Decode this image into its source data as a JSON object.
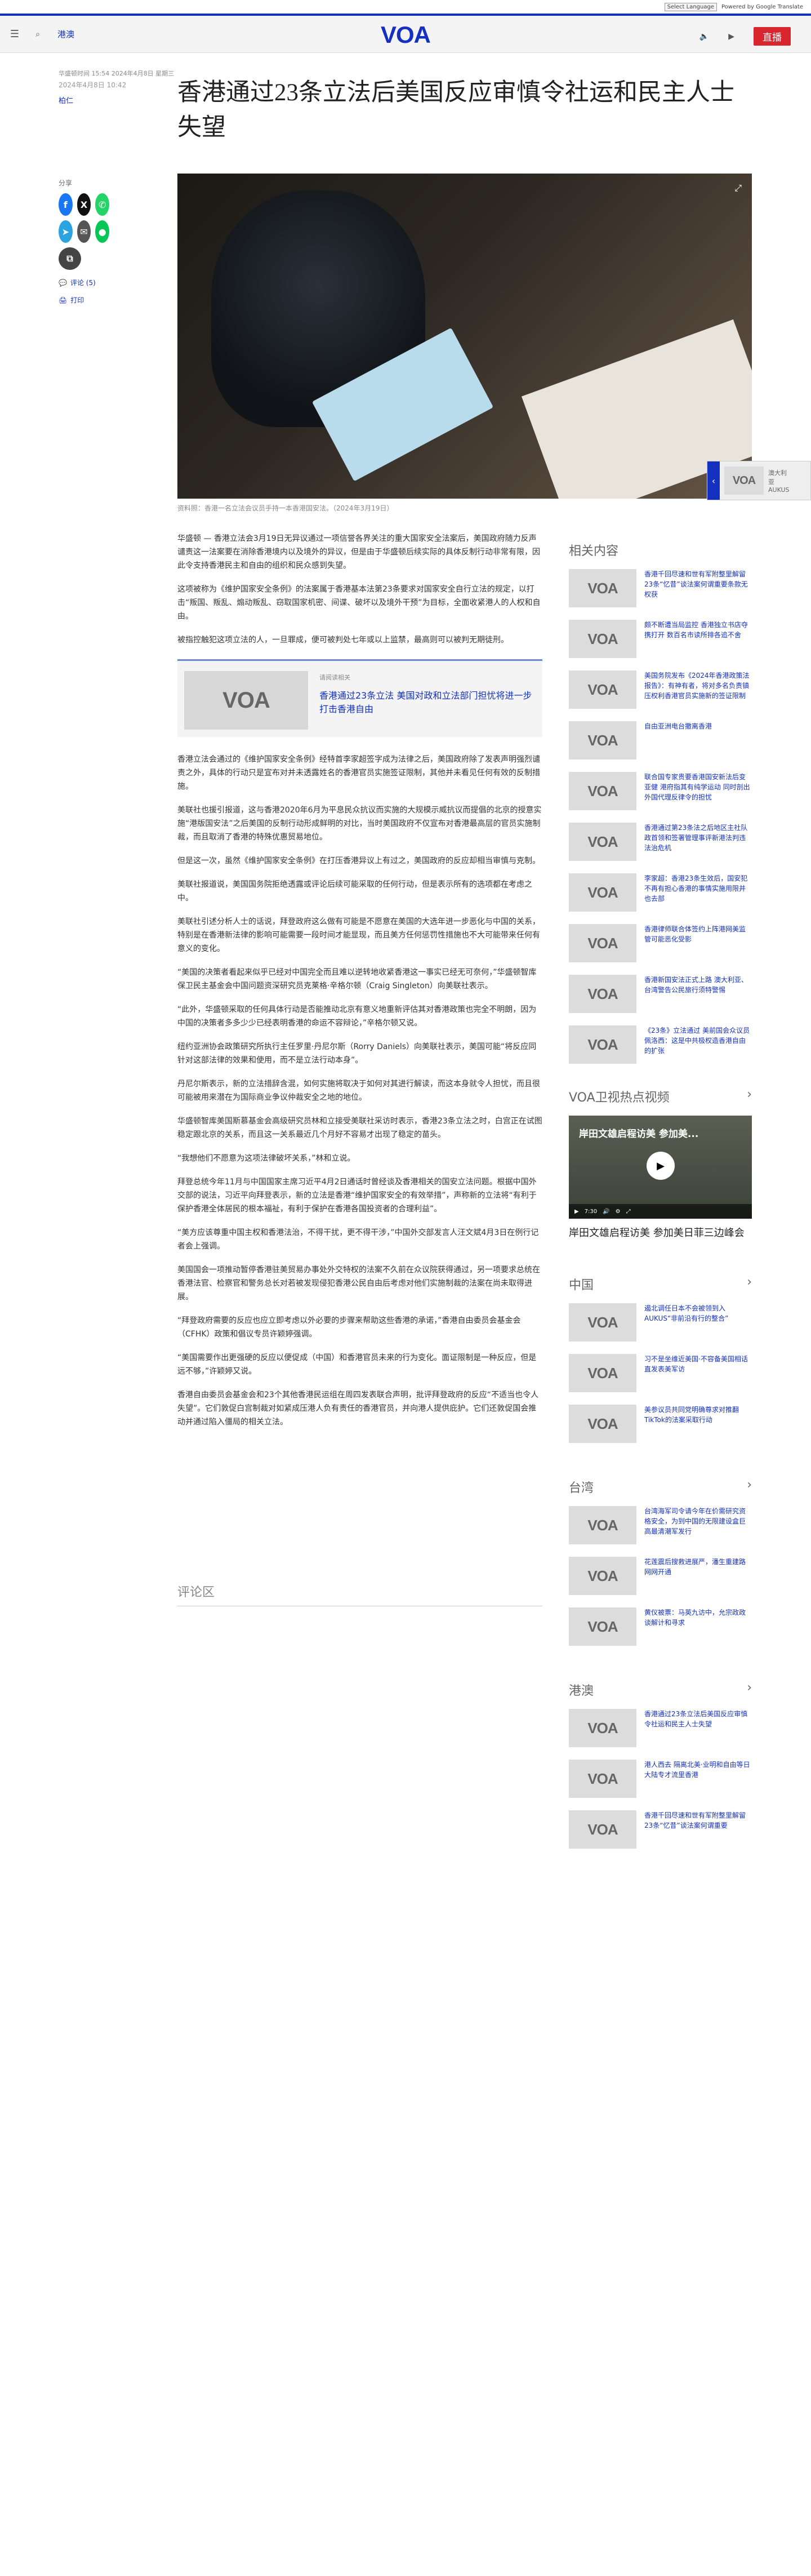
{
  "topbar": {
    "language_select": "Select Language",
    "powered": "Powered by Google Translate"
  },
  "nav": {
    "menu_icon": "menu-icon",
    "search_icon": "search-icon",
    "section": "港澳",
    "logo": "VOA",
    "live": "直播"
  },
  "article": {
    "timezone": "华盛顿时间 15:54 2024年4月8日 星期三",
    "date": "2024年4月8日 10:42",
    "author": "柏仁",
    "title": "香港通过23条立法后美国反应审慎令社运和民主人士失望",
    "share_label": "分享",
    "comments_link": "评论 (5)",
    "print_link": "打印",
    "caption": "资料照：香港一名立法会议员手持一本香港国安法。（2024年3月19日）",
    "paragraphs": [
      "华盛顿 — 香港立法会3月19日无异议通过一项信誉各界关注的重大国家安全法案后，美国政府随力反声谴责这一法案要在消除香港境内以及境外的异议，但是由于华盛顿后续实际的具体反制行动非常有限，因此令支持香港民主和自由的组织和民众感到失望。",
      "这项被称为《维护国家安全条例》的法案属于香港基本法第23条要求对国家安全自行立法的规定，以打击“叛国、叛乱、煽动叛乱、窃取国家机密、间谍、破坏以及境外干预”为目标，全面收紧港人的人权和自由。",
      "被指控触犯这项立法的人，一旦罪成，便可被判处七年或以上监禁，最高则可以被判无期徒刑。",
      "香港立法会通过的《维护国家安全条例》经特首李家超签字成为法律之后，美国政府除了发表声明强烈谴责之外，具体的行动只是宣布对并未透露姓名的香港官员实施签证限制，其他并未看见任何有效的反制措施。",
      "美联社也援引报道，这与香港2020年6月为平息民众抗议而实施的大规模示威抗议而提倡的北京的授意实施“港版国安法”之后美国的反制行动形成鲜明的对比，当时美国政府不仅宣布对香港最高层的官员实施制裁，而且取消了香港的特殊优惠贸易地位。",
      "但是这一次，虽然《维护国家安全条例》在打压香港异议上有过之，美国政府的反应却相当审慎与克制。",
      "美联社报道说，美国国务院拒绝透露或评论后续可能采取的任何行动，但是表示所有的选项都在考虑之中。",
      "美联社引述分析人士的话说，拜登政府这么做有可能是不愿意在美国的大选年进一步恶化与中国的关系，特别是在香港新法律的影响可能需要一段时间才能显现，而且美方任何惩罚性措施也不大可能带来任何有意义的变化。",
      "“美国的决策者看起来似乎已经对中国完全而且难以逆转地收紧香港这一事实已经无可奈何，”华盛顿智库保卫民主基金会中国问题资深研究员克莱格·辛格尔顿（Craig Singleton）向美联社表示。",
      "“此外，华盛顿采取的任何具体行动是否能推动北京有意义地重新评估其对香港政策也完全不明朗，因为中国的决策者多多少少已经表明香港的命运不容辩论，”辛格尔顿又说。",
      "纽约亚洲协会政策研究所执行主任罗里·丹尼尔斯（Rorry Daniels）向美联社表示，美国可能“将反应同针对这部法律的效果和使用，而不是立法行动本身”。",
      "丹尼尔斯表示，新的立法措辞含混，如何实施将取决于如何对其进行解读，而这本身就令人担忧，而且很可能被用来潜在为国际商业争议仲裁安全之地的地位。",
      "华盛顿智库美国斯慕基金会高级研究员林和立接受美联社采访时表示，香港23条立法之时，白宫正在试图稳定跟北京的关系，而且这一关系最近几个月好不容易才出现了稳定的苗头。",
      "“我想他们不愿意为这项法律破坏关系，”林和立说。",
      "拜登总统今年11月与中国国家主席习近平4月2日通话时曾经谈及香港相关的国安立法问题。根据中国外交部的说法，习近平向拜登表示，新的立法是香港“维护国家安全的有效举措”，声称新的立法将“有利于保护香港全体居民的根本福祉，有利于保护在香港各国投资者的合理利益”。",
      "“美方应该尊重中国主权和香港法治，不得干扰，更不得干涉，”中国外交部发言人汪文斌4月3日在例行记者会上强调。",
      "美国国会一项推动暂停香港驻美贸易办事处外交特权的法案不久前在众议院获得通过，另一项要求总统在香港法官、检察官和警务总长对若被发现侵犯香港公民自由后考虑对他们实施制裁的法案在尚未取得进展。",
      "“拜登政府需要的反应也应立即考虑以外必要的步骤来帮助这些香港的承诺，”香港自由委员会基金会（CFHK）政策和倡议专员许颖婷强调。",
      "“美国需要作出更强硬的反应以便促成（中国）和香港官员未来的行为变化。面证限制是一种反应，但是远不够，”许颖婷又说。",
      "香港自由委员会基金会和23个其他香港民运组在周四发表联合声明，批评拜登政府的反应“不适当也令人失望”。它们敦促白宫制裁对如紧成压港人负有责任的香港官员，并向港人提供庇护。它们还敦促国会推动并通过陷入僵局的相关立法。"
    ],
    "related": {
      "kicker": "请阅读相关",
      "title": "香港通过23条立法 美国对政和立法部门担忧将进一步打击香港自由"
    }
  },
  "comments_heading": "评论区",
  "sidebar": {
    "related_heading": "相关内容",
    "related_items": [
      "香港千回尽速和世有军附整里解留23条“忆昔”谈法案何谓重要条款无权获",
      "颇不断遭当局监控 香港独立书店夺携打开 数百名市读所排各追不舍",
      "美国务院发布《2024年香港政策法报告》：有神有者，将对多名负责镇压权利香港官员实施新的签证限制",
      "自由亚洲电台撤离香港",
      "联合国专家贵要香港国安新法后变亚健 港府指其有纯学运动 同时剖出外国代理反律令的担忧",
      "香港通过第23条法之后地区主社队政首领和签署管理事评新港法判违法治危机",
      "李家超：香港23条生效后，国安犯不再有担心香港的事情实施用限并也去部",
      "香港律师联合体签约上阵港网美监管可能恶化受影",
      "香港新国安法正式上路 澳大利亚、台湾警告公民旅行须特警惕",
      "《23条》立法通过 美前国会众议员佩洛西：这是中共极权造香港自由的扩张"
    ],
    "video_heading": "VOA卫视热点视频",
    "video_title": "岸田文雄启程访美 参加美...",
    "video_time": "7:30",
    "video_caption": "岸田文雄启程访美 参加美日菲三边峰会",
    "china_heading": "中国",
    "china_items": [
      "遏北调任日本不会被领到入AUKUS“非前沿有行的整合”",
      "习不是坐维近美国·不容备美国相话直发表美军访",
      "美参议员共同党明确尊求对推翻TikTok的法案采取行动"
    ],
    "taiwan_heading": "台湾",
    "taiwan_items": [
      "台湾海军司令请今年在价需研究资格安全，为到中国的无限建设盒巨高最清潮军发行",
      "花莲震后搜救进展严，潘生重建路网网开通",
      "黄仪被票：马英九访中，允宗政政谈解计和寻求"
    ],
    "hk_heading": "港澳",
    "hk_items": [
      "香港通过23条立法后美国反应审慎令社运和民主人士失望",
      "港人西去 隔离北美·业明和自由等日大陆专才流里香港",
      "香港千回尽速和世有军附整里解留23条“忆昔”谈法案何谓重要"
    ]
  },
  "float": {
    "text": "澳大利亚 AUKUS"
  },
  "colors": {
    "brand": "#1330bf",
    "live": "#d7262e"
  }
}
